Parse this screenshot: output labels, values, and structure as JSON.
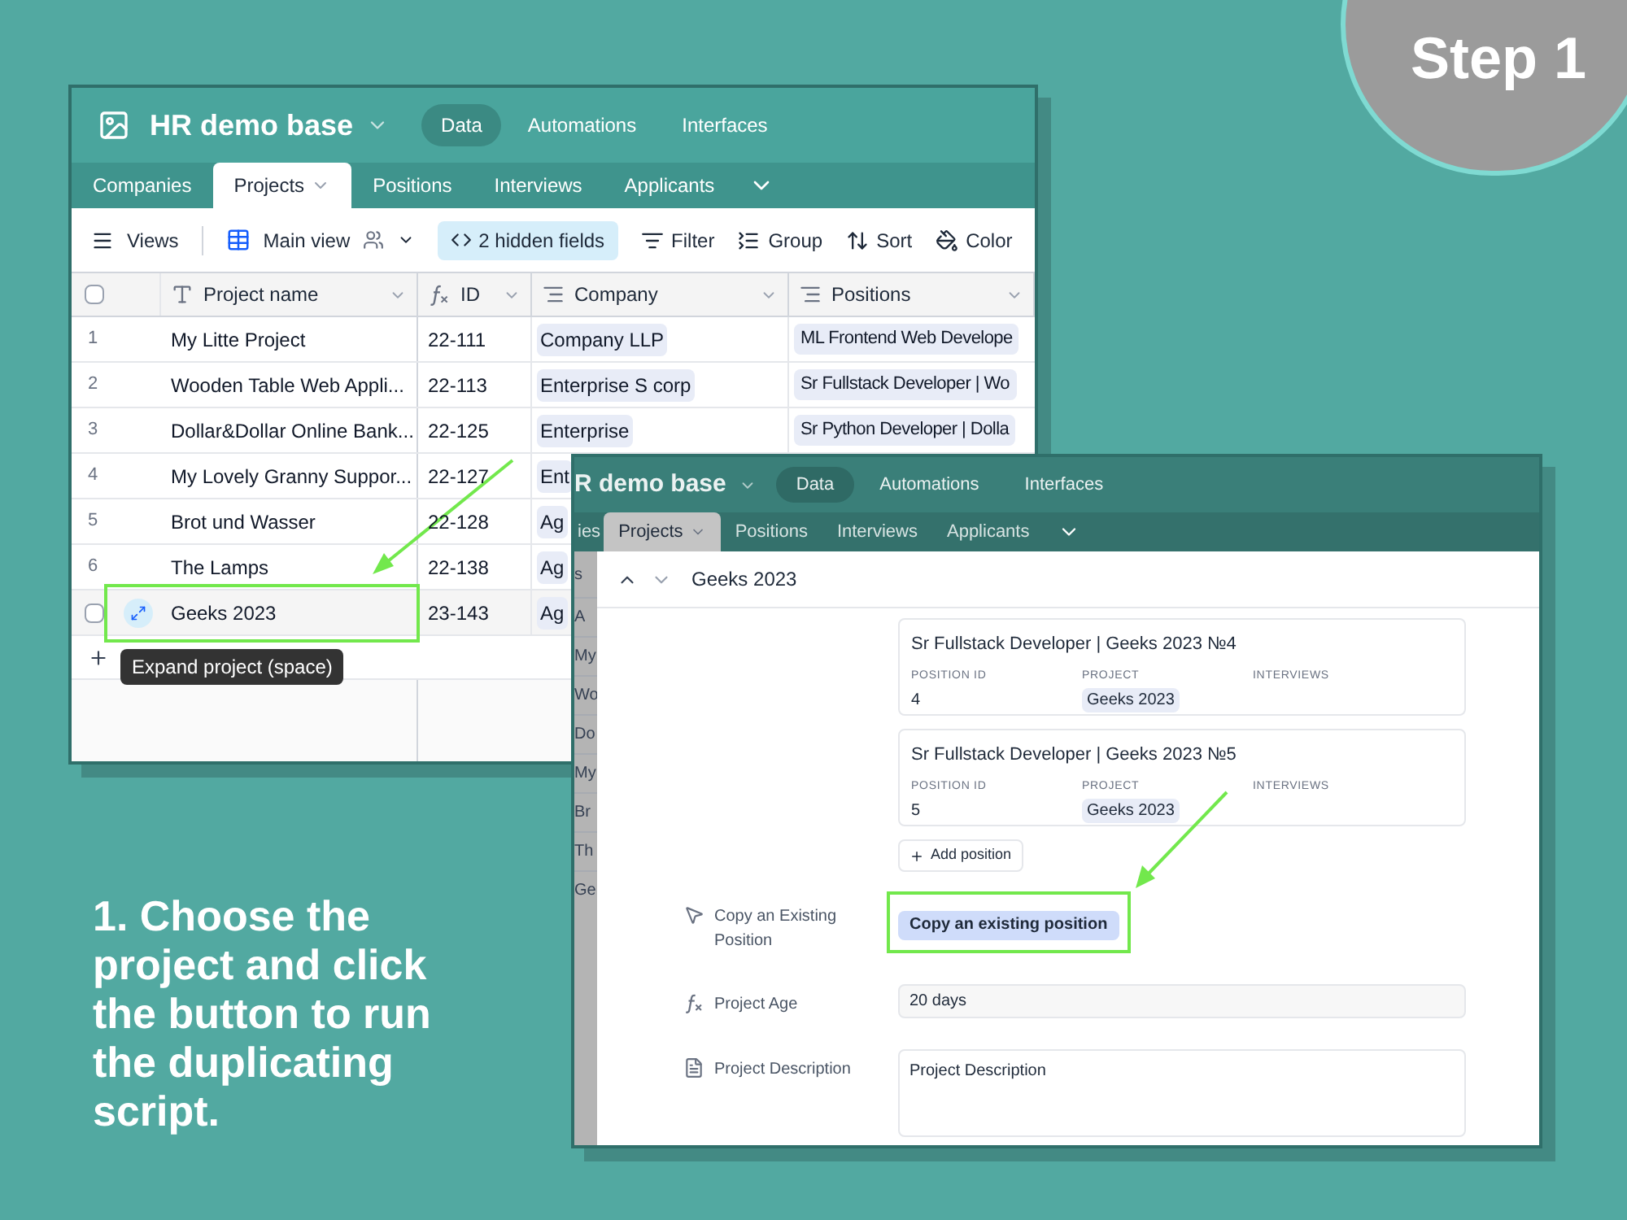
{
  "step_badge": {
    "label": "Step 1"
  },
  "instruction": "1. Choose the project and click the button to run the duplicating script.",
  "grid_window": {
    "base_title": "HR demo base",
    "nav": [
      {
        "label": "Data",
        "selected": true
      },
      {
        "label": "Automations",
        "selected": false
      },
      {
        "label": "Interfaces",
        "selected": false
      }
    ],
    "tables": [
      {
        "label": "Companies",
        "selected": false
      },
      {
        "label": "Projects",
        "selected": true
      },
      {
        "label": "Positions",
        "selected": false
      },
      {
        "label": "Interviews",
        "selected": false
      },
      {
        "label": "Applicants",
        "selected": false
      }
    ],
    "toolbar": {
      "views": "Views",
      "view_name": "Main view",
      "hidden_fields": "2 hidden fields",
      "actions": [
        {
          "kind": "filter",
          "label": "Filter"
        },
        {
          "kind": "group",
          "label": "Group"
        },
        {
          "kind": "sort",
          "label": "Sort"
        },
        {
          "kind": "color",
          "label": "Color"
        }
      ]
    },
    "select_all": {
      "checked": false
    },
    "columns": [
      {
        "kind": "text",
        "label": "Project name"
      },
      {
        "kind": "formula",
        "label": "ID"
      },
      {
        "kind": "link",
        "label": "Company"
      },
      {
        "kind": "link",
        "label": "Positions"
      }
    ],
    "rows": [
      {
        "number": "1",
        "name": "My Litte Project",
        "id": "22-111",
        "company": "Company LLP",
        "position": "ML Frontend Web Develope",
        "hovered": false,
        "highlighted": false
      },
      {
        "number": "2",
        "name": "Wooden Table Web Appli...",
        "id": "22-113",
        "company": "Enterprise S corp",
        "position": "Sr Fullstack Developer | Wo",
        "hovered": false,
        "highlighted": false
      },
      {
        "number": "3",
        "name": "Dollar&Dollar Online Bank...",
        "id": "22-125",
        "company": "Enterprise",
        "position": "Sr Python Developer | Dolla",
        "hovered": false,
        "highlighted": false
      },
      {
        "number": "4",
        "name": "My Lovely Granny Suppor...",
        "id": "22-127",
        "company": "Ent",
        "hovered": false,
        "highlighted": false
      },
      {
        "number": "5",
        "name": "Brot und Wasser",
        "id": "22-128",
        "company": "Ag",
        "hovered": false,
        "highlighted": false
      },
      {
        "number": "6",
        "name": "The Lamps",
        "id": "22-138",
        "company": "Ag",
        "hovered": false,
        "highlighted": false
      },
      {
        "name": "Geeks 2023",
        "id": "23-143",
        "company": "Ag",
        "hovered": true,
        "checked": false,
        "highlighted": true
      }
    ],
    "tooltip": "Expand project (space)"
  },
  "record_window": {
    "base_title": "R demo base",
    "nav": [
      {
        "label": "Data",
        "selected": true
      },
      {
        "label": "Automations",
        "selected": false
      },
      {
        "label": "Interfaces",
        "selected": false
      }
    ],
    "tables": [
      {
        "label": "ies",
        "selected": false
      },
      {
        "label": "Projects",
        "selected": true
      },
      {
        "label": "Positions",
        "selected": false
      },
      {
        "label": "Interviews",
        "selected": false
      },
      {
        "label": "Applicants",
        "selected": false
      }
    ],
    "behind_fragments": [
      "s",
      "A",
      "My",
      "Wo",
      "Do",
      "My",
      "Br",
      "Th",
      "Ge"
    ],
    "record_title": "Geeks 2023",
    "linked_positions": [
      {
        "title": "Sr Fullstack Developer | Geeks 2023 №4",
        "fields": [
          {
            "kind": "text",
            "label": "POSITION ID",
            "value": "4"
          },
          {
            "kind": "link",
            "label": "PROJECT",
            "value": "Geeks 2023"
          },
          {
            "kind": "link",
            "label": "INTERVIEWS"
          }
        ]
      },
      {
        "title": "Sr Fullstack Developer | Geeks 2023 №5",
        "fields": [
          {
            "kind": "text",
            "label": "POSITION ID",
            "value": "5"
          },
          {
            "kind": "link",
            "label": "PROJECT",
            "value": "Geeks 2023"
          },
          {
            "kind": "link",
            "label": "INTERVIEWS"
          }
        ]
      }
    ],
    "add_button": "Add position",
    "fields": [
      {
        "kind": "button",
        "label": "Copy an Existing Position",
        "value": "Copy an existing position",
        "highlighted": true
      },
      {
        "kind": "formula",
        "label": "Project Age",
        "value": "20 days",
        "highlighted": false
      },
      {
        "kind": "long_text",
        "label": "Project Description",
        "value": "Project Description",
        "highlighted": false
      }
    ]
  }
}
